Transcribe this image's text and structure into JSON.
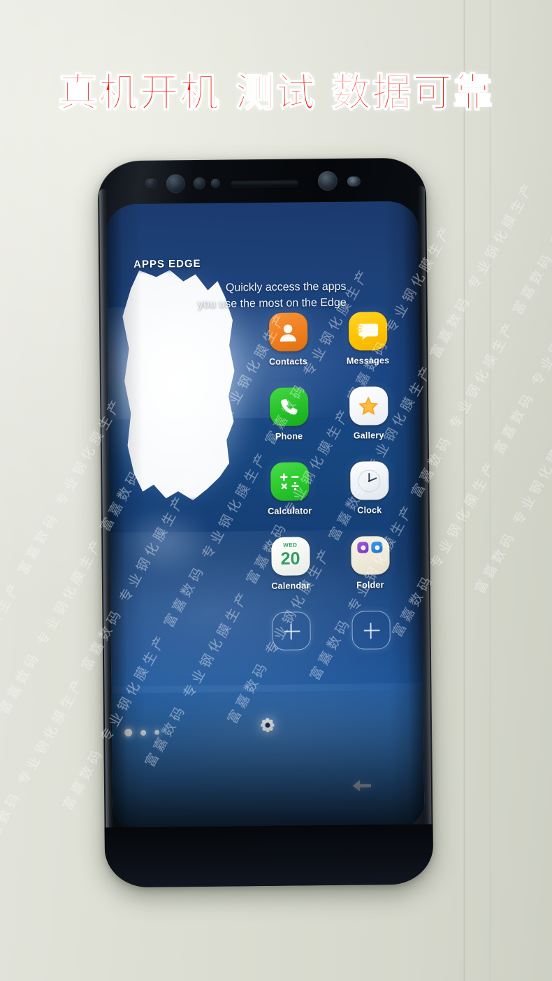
{
  "headline": {
    "text": "真机开机 测试 数据可靠",
    "color": "#f31c0d"
  },
  "background": {
    "color": "#e4e5dc"
  },
  "watermark": {
    "text": "富嘉数码 专业钢化膜生产",
    "repeat_count": 11,
    "rotation_deg": -61
  },
  "phone": {
    "hardware": {
      "earpiece": "earpiece-speaker",
      "front_camera": "front-camera",
      "iris_scanner": "iris-scanner",
      "proximity_sensor": "proximity-sensor"
    },
    "screen": {
      "panel": {
        "title": "APPS EDGE",
        "subtitle_line1": "Quickly access the apps",
        "subtitle_line2": "you use the most on the Edge"
      },
      "apps": [
        {
          "label": "Contacts",
          "icon": "contacts-icon",
          "color": "#ef7f1f"
        },
        {
          "label": "Messages",
          "icon": "messages-icon",
          "color": "#fec400"
        },
        {
          "label": "Phone",
          "icon": "phone-icon",
          "color": "#26c12a"
        },
        {
          "label": "Gallery",
          "icon": "gallery-icon",
          "color": "#ffffff"
        },
        {
          "label": "Calculator",
          "icon": "calculator-icon",
          "color": "#2bc82e"
        },
        {
          "label": "Clock",
          "icon": "clock-icon",
          "color": "#ffffff"
        },
        {
          "label": "Calendar",
          "icon": "calendar-icon",
          "color": "#ffffff"
        },
        {
          "label": "Folder",
          "icon": "folder-icon",
          "color": "#efeada"
        }
      ],
      "calendar_icon": {
        "weekday": "WED",
        "date": "20"
      },
      "empty_slots": [
        {
          "icon": "add-app-icon",
          "label": "+"
        },
        {
          "icon": "add-app-icon",
          "label": "+"
        }
      ],
      "page_indicator": {
        "total": 3,
        "active": 1
      },
      "controls": {
        "settings": "settings-gear-icon",
        "back": "back-arrow-icon"
      }
    }
  }
}
